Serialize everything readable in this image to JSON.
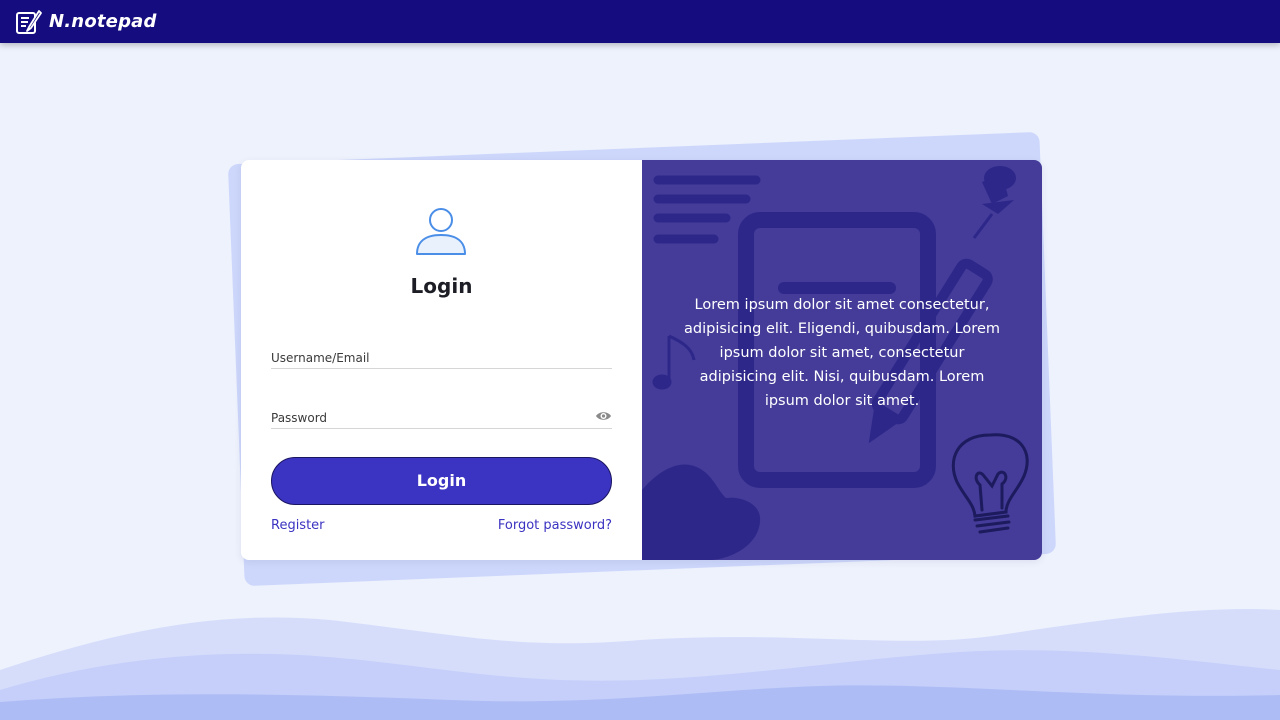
{
  "app": {
    "brand_name": "N.notepad",
    "logo_icon": "notepad-pen-icon"
  },
  "login": {
    "title": "Login",
    "user_icon": "user-icon",
    "username_placeholder": "Username/Email",
    "username_value": "",
    "password_placeholder": "Password",
    "password_value": "",
    "password_toggle_icon": "eye-icon",
    "submit_label": "Login",
    "register_label": "Register",
    "forgot_label": "Forgot password?"
  },
  "promo": {
    "text": "Lorem ipsum dolor sit amet consectetur, adipisicing elit. Eligendi, quibusdam. Lorem ipsum dolor sit amet, consectetur adipisicing elit. Nisi, quibusdam. Lorem ipsum dolor sit amet."
  },
  "colors": {
    "topbar": "#150c80",
    "page_background": "#eef2fd",
    "accent": "#3b33c1",
    "promo_panel": "#443c98",
    "back_sheet": "#cdd7fb"
  }
}
